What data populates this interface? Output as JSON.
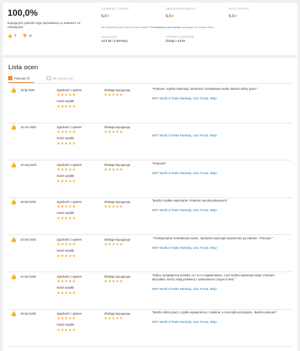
{
  "summary": {
    "percent": "100,0%",
    "description": "kupujących poleciło tego sprzedawcę w ostatnich 12 miesiącach",
    "positive_count": "7",
    "negative_count": "0",
    "ratings": [
      {
        "label": "ZGODNOŚĆ Z OPISEM",
        "value": "5,0"
      },
      {
        "label": "OBSŁUGA KUPUJĄCEGO",
        "value": "5,0"
      },
      {
        "label": "KOSZT WYSYŁKI",
        "value": "5,0"
      }
    ],
    "note_text": "Nie wyświetlamy jak ocenę za czas wysyłki.",
    "note_link": "Przewidywany czas dostawy",
    "note_suffix": "nakazujący nie zmienia oferty.",
    "on_allegro_label": "NA ALLEGRO",
    "on_allegro_value": "od 4 lat i 3 miesięcy",
    "last_login_label": "OSTATNIE LOGOWANIE",
    "last_login_value": "dzisiaj o 13:45",
    "star": "★"
  },
  "reviews_section": {
    "title": "Lista ocen",
    "filter_recommend": "Polecam (7)",
    "filter_not_recommend": "Nie polecam (0)",
    "label_description": "Zgodność z opisem",
    "label_service": "Obsługa kupującego",
    "label_shipping": "Koszt wysyłki",
    "stars": "★★★★★",
    "items": [
      {
        "date": "18 lip 2020",
        "comment": "\"Polecam, szybka realizacja, konkretna i kontaktowa osoba. Bardzo dobry gracz.\"",
        "auction": "WOT World of Tanks Rankedy, Linie Frontu, Misje"
      },
      {
        "date": "15 cze 2020",
        "comment": "",
        "auction": "WOT World of Tanks Rankedy, Linie Frontu, Misje"
      },
      {
        "date": "10 maj 2020",
        "comment": "\"Polecam!\"",
        "auction": "WOT World of Tanks Rankedy, Linie Frontu, Misje"
      },
      {
        "date": "26 kwi 2020",
        "comment": "\"Bardzo szybkie wykonanie. Polecam niezdecydowanym!\"",
        "auction": "WOT World of Tanks Rankedy, Linie Frontu, Misje"
      },
      {
        "date": "23 kwi 2020",
        "comment": "\" Profesjonalna i kontaktowa osoba . Sprawnie wykonujie powierzone jej zadanie . Polecam \"",
        "auction": "WOT World of Tanks Rankedy, Linie Frontu, Misje"
      },
      {
        "date": "22 kwi 2020",
        "comment": "\"Dobry, sympatyczny kontakt, no i to co najważniejsze, czyli szybko wykonana misja. Polecam wszystkim, którzy mają problemy z wykonaniem czegoś w Wot. \"",
        "auction": "WOT World of Tanks Rankedy, Linie Frontu, Misje"
      },
      {
        "date": "09 kwi 2020",
        "comment": "\"Bardzo dobry gracz, szybko wywiązał się z zadania, a cena była przystępna - Bardzo polecam\"",
        "auction": "WOT World of Tanks Rankedy, Linie Frontu, Misje"
      }
    ]
  }
}
